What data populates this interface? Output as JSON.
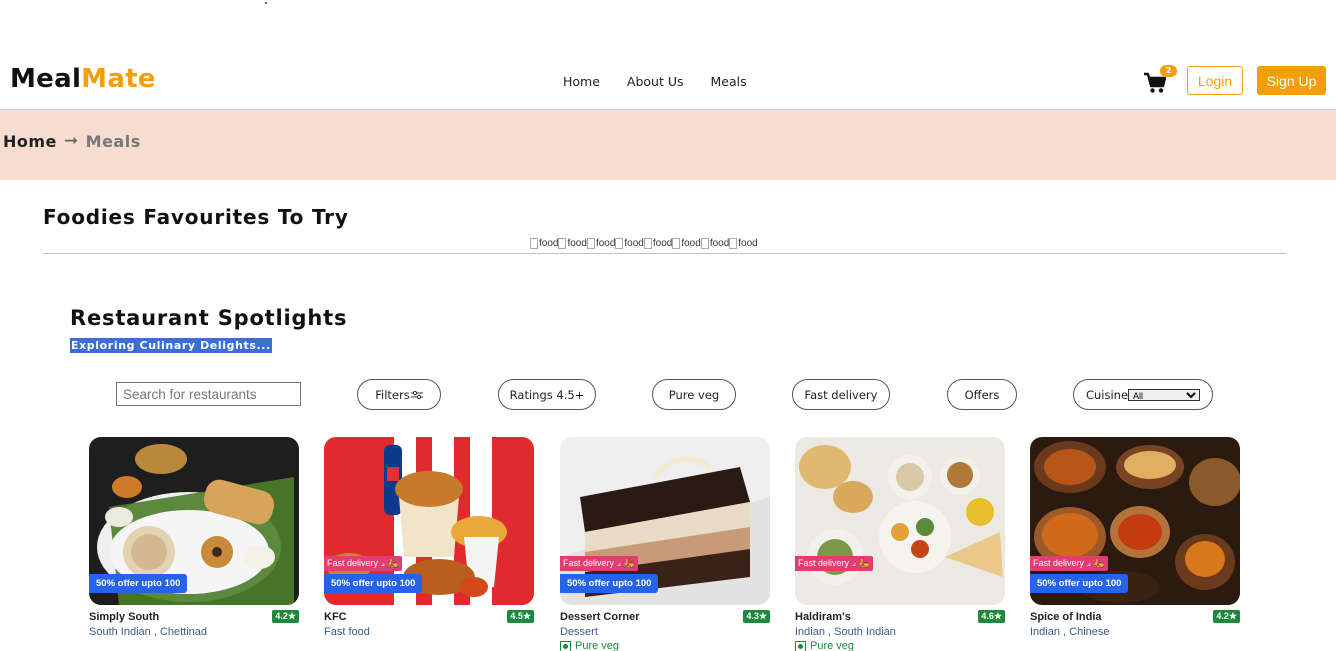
{
  "header": {
    "logo_part1": "Meal",
    "logo_part2": "Mate",
    "nav": [
      "Home",
      "About Us",
      "Meals"
    ],
    "cart_count": "2",
    "login_label": "Login",
    "signup_label": "Sign Up"
  },
  "breadcrumb": {
    "home": "Home",
    "arrow": "➞",
    "current": "Meals"
  },
  "foodies": {
    "title": "Foodies Favourites To Try",
    "image_alts": [
      "food",
      "food",
      "food",
      "food",
      "food",
      "food",
      "food",
      "food"
    ]
  },
  "spotlights": {
    "title": "Restaurant Spotlights",
    "subtitle": "Exploring Culinary Delights..."
  },
  "filters": {
    "search_placeholder": "Search for restaurants",
    "filters_label": "Filters",
    "ratings_label": "Ratings 4.5+",
    "pure_veg_label": "Pure veg",
    "fast_delivery_label": "Fast delivery",
    "offers_label": "Offers",
    "cuisine_label": "Cuisine",
    "cuisine_selected": "All"
  },
  "restaurants": [
    {
      "name": "Simply South",
      "rating": "4.2★",
      "cuisine": "South Indian , Chettinad",
      "offer": "50% offer upto 100",
      "fast_delivery": "",
      "pure_veg": ""
    },
    {
      "name": "KFC",
      "rating": "4.5★",
      "cuisine": "Fast food",
      "offer": "50% offer upto 100",
      "fast_delivery": "Fast delivery ⟓ 🛵",
      "pure_veg": ""
    },
    {
      "name": "Dessert Corner",
      "rating": "4.3★",
      "cuisine": "Dessert",
      "offer": "50% offer upto 100",
      "fast_delivery": "Fast delivery ⟓ 🛵",
      "pure_veg": "Pure veg"
    },
    {
      "name": "Haldiram's",
      "rating": "4.6★",
      "cuisine": "Indian , South Indian",
      "offer": "",
      "fast_delivery": "Fast delivery ⟓ 🛵",
      "pure_veg": "Pure veg"
    },
    {
      "name": "Spice of India",
      "rating": "4.2★",
      "cuisine": "Indian , Chinese",
      "offer": "50% offer upto 100",
      "fast_delivery": "Fast delivery ⟓ 🛵",
      "pure_veg": ""
    }
  ],
  "colors": {
    "accent": "#f59e0b",
    "breadcrumb_bg": "#f6ddcf",
    "offer_badge": "#2563eb",
    "fast_badge": "#e23d71",
    "rating_badge": "#1c8a3a"
  },
  "icons": {
    "cart": "cart-icon",
    "filters": "sliders-icon",
    "veg": "veg-mark-icon"
  }
}
